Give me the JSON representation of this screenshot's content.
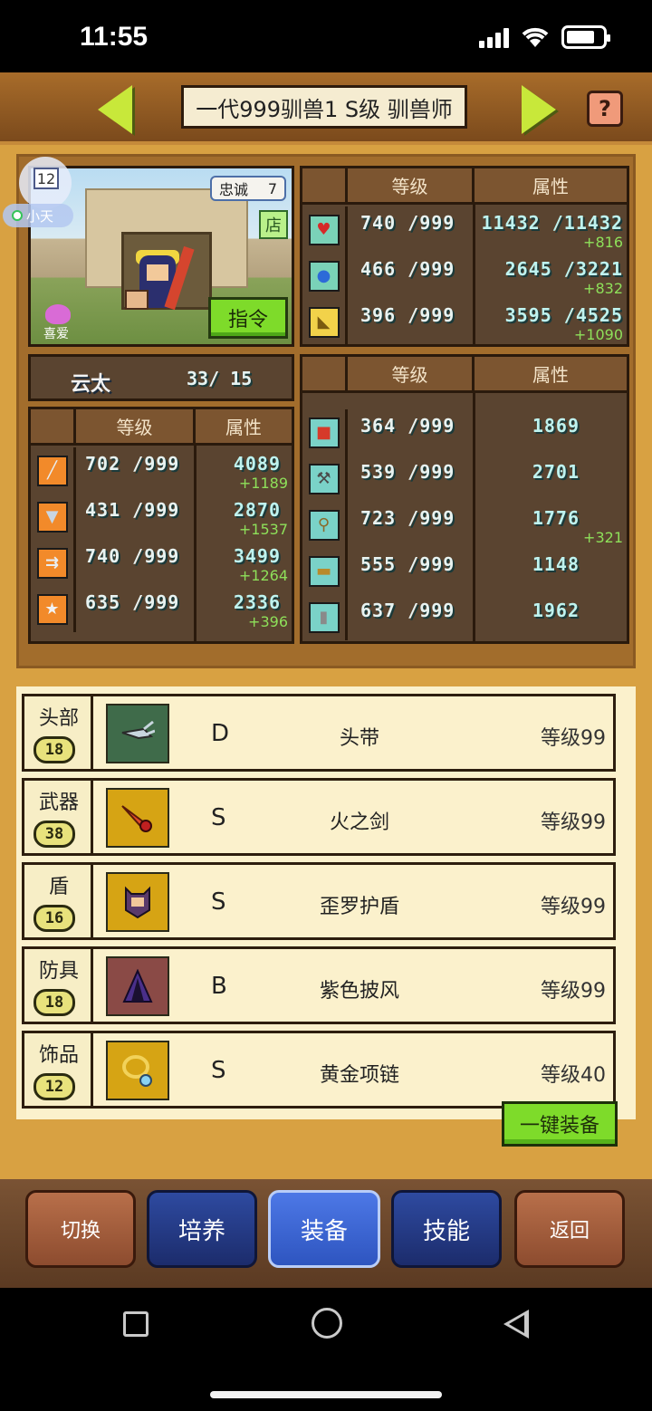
{
  "status": {
    "time": "11:55"
  },
  "header": {
    "title": "一代999驯兽1 S级 驯兽师",
    "help": "?"
  },
  "profile": {
    "level": "12",
    "master_name": "小天",
    "loyalty_label": "忠诚",
    "loyalty_value": "7",
    "shop_label": "店",
    "command_label": "指令",
    "like_label": "喜爱",
    "name": "云太",
    "name_value": "33/  15"
  },
  "top_stats": {
    "col_level": "等级",
    "col_attr": "属性",
    "rows": [
      {
        "icon": "heart-icon",
        "level": "740 /999",
        "attr": "11432 /11432",
        "bonus": "+816"
      },
      {
        "icon": "potion-icon",
        "level": "466 /999",
        "attr": "2645 /3221",
        "bonus": "+832"
      },
      {
        "icon": "muscle-icon",
        "level": "396 /999",
        "attr": "3595 /4525",
        "bonus": "+1090"
      }
    ]
  },
  "combat_stats": {
    "col_level": "等级",
    "col_attr": "属性",
    "rows": [
      {
        "icon": "sword-icon",
        "level": "702 /999",
        "attr": "4089",
        "bonus": "+1189"
      },
      {
        "icon": "shield-icon",
        "level": "431 /999",
        "attr": "2870",
        "bonus": "+1537"
      },
      {
        "icon": "arrows-icon",
        "level": "740 /999",
        "attr": "3499",
        "bonus": "+1264"
      },
      {
        "icon": "star-icon",
        "level": "635 /999",
        "attr": "2336",
        "bonus": "+396"
      }
    ]
  },
  "work_stats": {
    "col_level": "等级",
    "col_attr": "属性",
    "rows": [
      {
        "icon": "book-icon",
        "level": "364 /999",
        "attr": "1869",
        "bonus": ""
      },
      {
        "icon": "pickaxe-icon",
        "level": "539 /999",
        "attr": "2701",
        "bonus": ""
      },
      {
        "icon": "shovel-icon",
        "level": "723 /999",
        "attr": "1776",
        "bonus": "+321"
      },
      {
        "icon": "basket-icon",
        "level": "555 /999",
        "attr": "1148",
        "bonus": ""
      },
      {
        "icon": "hammer-icon",
        "level": "637 /999",
        "attr": "1962",
        "bonus": ""
      }
    ]
  },
  "equipment": [
    {
      "slot": "头部",
      "slot_level": "18",
      "grade": "D",
      "name": "头带",
      "level": "等级99",
      "bg": "#3f6b4a",
      "icon": "headband-icon"
    },
    {
      "slot": "武器",
      "slot_level": "38",
      "grade": "S",
      "name": "火之剑",
      "level": "等级99",
      "bg": "#d6a414",
      "icon": "fire-sword-icon"
    },
    {
      "slot": "盾",
      "slot_level": "16",
      "grade": "S",
      "name": "歪罗护盾",
      "level": "等级99",
      "bg": "#d6a414",
      "icon": "cat-shield-icon"
    },
    {
      "slot": "防具",
      "slot_level": "18",
      "grade": "B",
      "name": "紫色披风",
      "level": "等级99",
      "bg": "#8a4a46",
      "icon": "purple-cape-icon"
    },
    {
      "slot": "饰品",
      "slot_level": "12",
      "grade": "S",
      "name": "黄金项链",
      "level": "等级40",
      "bg": "#d6a414",
      "icon": "gold-necklace-icon"
    }
  ],
  "equip_all_label": "一键装备",
  "tabs": [
    {
      "label": "切换",
      "style": "brown"
    },
    {
      "label": "培养",
      "style": "navy"
    },
    {
      "label": "装备",
      "style": "active"
    },
    {
      "label": "技能",
      "style": "navy"
    },
    {
      "label": "返回",
      "style": "brown"
    }
  ]
}
